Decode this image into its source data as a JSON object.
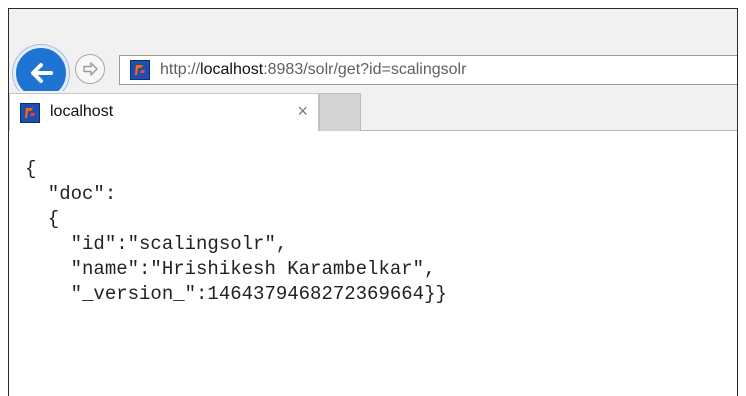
{
  "browser": {
    "address_bar": {
      "scheme": "http://",
      "host": "localhost",
      "path": ":8983/solr/get?id=scalingsolr"
    },
    "tab": {
      "title": "localhost",
      "close_glyph": "×"
    },
    "icons": {
      "back": "back-arrow-icon",
      "forward": "forward-arrow-icon",
      "favicon": "site-favicon-icon",
      "close": "close-icon"
    },
    "colors": {
      "back_button": "#1f73d3",
      "favicon": "#1e4fae",
      "favicon_accent": "#ff6a00"
    }
  },
  "content": {
    "lines": [
      "{",
      "  \"doc\":",
      "  {",
      "    \"id\":\"scalingsolr\",",
      "    \"name\":\"Hrishikesh Karambelkar\",",
      "    \"_version_\":1464379468272369664}}"
    ]
  }
}
